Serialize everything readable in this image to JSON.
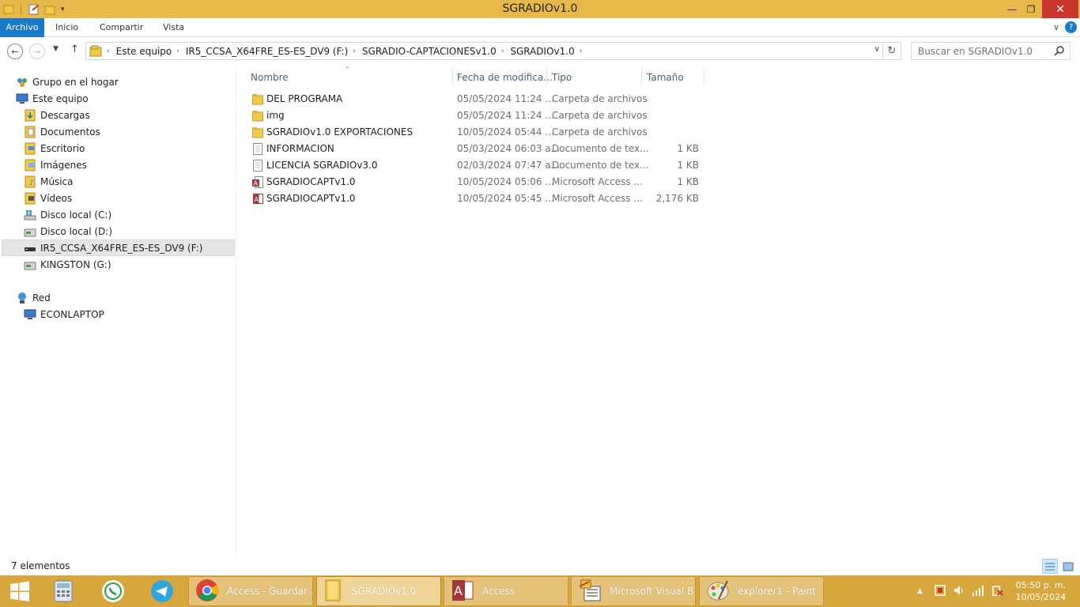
{
  "window": {
    "title": "SGRADIOv1.0"
  },
  "ribbon": {
    "tabs": [
      "Archivo",
      "Inicio",
      "Compartir",
      "Vista"
    ]
  },
  "address": {
    "crumbs": [
      "Este equipo",
      "IR5_CCSA_X64FRE_ES-ES_DV9 (F:)",
      "SGRADIO-CAPTACIONESv1.0",
      "SGRADIOv1.0"
    ]
  },
  "search": {
    "placeholder": "Buscar en SGRADIOv1.0"
  },
  "navpane": {
    "items": [
      {
        "label": "Grupo en el hogar",
        "icon": "homegroup-icon"
      },
      {
        "label": "Este equipo",
        "icon": "computer-icon"
      },
      {
        "label": "Descargas",
        "icon": "downloads-folder-icon"
      },
      {
        "label": "Documentos",
        "icon": "documents-folder-icon"
      },
      {
        "label": "Escritorio",
        "icon": "desktop-folder-icon"
      },
      {
        "label": "Imágenes",
        "icon": "pictures-folder-icon"
      },
      {
        "label": "Música",
        "icon": "music-folder-icon"
      },
      {
        "label": "Vídeos",
        "icon": "videos-folder-icon"
      },
      {
        "label": "Disco local (C:)",
        "icon": "windows-drive-icon"
      },
      {
        "label": "Disco local (D:)",
        "icon": "drive-icon"
      },
      {
        "label": "IR5_CCSA_X64FRE_ES-ES_DV9 (F:)",
        "icon": "usb-drive-icon"
      },
      {
        "label": "KINGSTON (G:)",
        "icon": "drive-icon"
      },
      {
        "label": "Red",
        "icon": "network-icon"
      },
      {
        "label": "ECONLAPTOP",
        "icon": "computer-icon"
      }
    ]
  },
  "columns": {
    "name": "Nombre",
    "date": "Fecha de modifica...",
    "type": "Tipo",
    "size": "Tamaño"
  },
  "files": [
    {
      "name": "DEL PROGRAMA",
      "date": "05/05/2024 11:24 ...",
      "type": "Carpeta de archivos",
      "size": "",
      "icon": "folder-icon"
    },
    {
      "name": "img",
      "date": "05/05/2024 11:24 ...",
      "type": "Carpeta de archivos",
      "size": "",
      "icon": "folder-icon"
    },
    {
      "name": "SGRADIOv1.0 EXPORTACIONES",
      "date": "10/05/2024 05:44 ...",
      "type": "Carpeta de archivos",
      "size": "",
      "icon": "folder-icon"
    },
    {
      "name": "INFORMACION",
      "date": "05/03/2024 06:03 a...",
      "type": "Documento de tex...",
      "size": "1 KB",
      "icon": "text-file-icon"
    },
    {
      "name": "LICENCIA SGRADIOv3.0",
      "date": "02/03/2024 07:47 a...",
      "type": "Documento de tex...",
      "size": "1 KB",
      "icon": "text-file-icon"
    },
    {
      "name": "SGRADIOCAPTv1.0",
      "date": "10/05/2024 05:06 ...",
      "type": "Microsoft Access ...",
      "size": "1 KB",
      "icon": "access-lock-file-icon"
    },
    {
      "name": "SGRADIOCAPTv1.0",
      "date": "10/05/2024 05:45 ...",
      "type": "Microsoft Access ...",
      "size": "2,176 KB",
      "icon": "access-database-icon"
    }
  ],
  "status": {
    "count": "7 elementos"
  },
  "taskbar": {
    "apps": [
      {
        "label": "Access - Guardar ...",
        "icon": "chrome-icon"
      },
      {
        "label": "SGRADIOv1.0",
        "icon": "explorer-folder-icon"
      },
      {
        "label": "Access",
        "icon": "access-app-icon"
      },
      {
        "label": "Microsoft Visual B...",
        "icon": "visual-basic-icon"
      },
      {
        "label": "explorer1 - Paint",
        "icon": "paint-icon"
      }
    ],
    "time": "05:50 p. m.",
    "date": "10/05/2024"
  },
  "colors": {
    "titlebar": "#e8b84a",
    "taskbar": "#d7a63d",
    "accent": "#1979ca",
    "close": "#c7352b"
  }
}
